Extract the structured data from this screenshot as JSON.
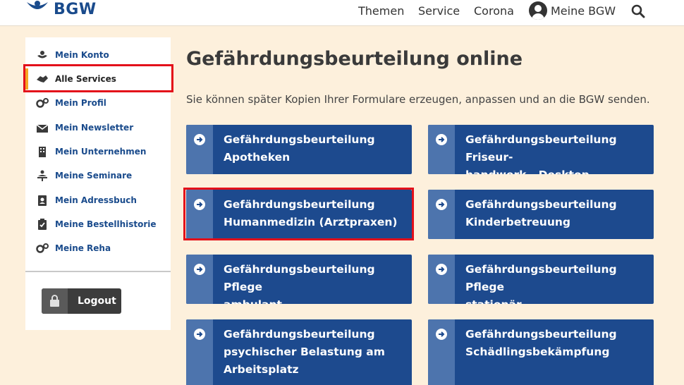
{
  "header": {
    "logo_text": "BGW",
    "nav": [
      "Themen",
      "Service",
      "Corona"
    ],
    "account_label": "Meine BGW"
  },
  "sidebar": {
    "items": [
      {
        "label": "Mein Konto",
        "icon": "hand-heart-icon"
      },
      {
        "label": "Alle Services",
        "icon": "handshake-icon",
        "active": true
      },
      {
        "label": "Mein Profil",
        "icon": "gears-icon"
      },
      {
        "label": "Mein Newsletter",
        "icon": "newsletter-icon"
      },
      {
        "label": "Mein Unternehmen",
        "icon": "building-icon"
      },
      {
        "label": "Meine Seminare",
        "icon": "presenter-icon"
      },
      {
        "label": "Mein Adressbuch",
        "icon": "address-book-icon"
      },
      {
        "label": "Meine Bestellhistorie",
        "icon": "clipboard-check-icon"
      },
      {
        "label": "Meine Reha",
        "icon": "gears-icon"
      }
    ],
    "logout_label": "Logout"
  },
  "main": {
    "title": "Gefährdungsbeurteilung online",
    "intro": "Sie können später Kopien Ihrer Formulare erzeugen, anpassen und an die BGW senden.",
    "cards": [
      {
        "line1": "Gefährdungsbeurteilung",
        "line2": "Apotheken",
        "line3": ""
      },
      {
        "line1": "Gefährdungsbeurteilung Friseur-",
        "line2": "handwerk - Desktop",
        "line3": ""
      },
      {
        "line1": "Gefährdungsbeurteilung",
        "line2": "Humanmedizin (Arztpraxen)",
        "line3": ""
      },
      {
        "line1": "Gefährdungsbeurteilung",
        "line2": "Kinderbetreuung",
        "line3": ""
      },
      {
        "line1": "Gefährdungsbeurteilung Pflege",
        "line2": "ambulant",
        "line3": ""
      },
      {
        "line1": "Gefährdungsbeurteilung Pflege",
        "line2": "stationär",
        "line3": ""
      },
      {
        "line1": "Gefährdungsbeurteilung",
        "line2": "psychischer Belastung am",
        "line3": "Arbeitsplatz"
      },
      {
        "line1": "Gefährdungsbeurteilung",
        "line2": "Schädlingsbekämpfung",
        "line3": ""
      }
    ]
  },
  "colors": {
    "brand_blue": "#1d4a8e",
    "card_strip": "#4d74ad",
    "background": "#fdf0dc",
    "highlight_red": "#e3101a",
    "active_marker": "#f5a623"
  }
}
